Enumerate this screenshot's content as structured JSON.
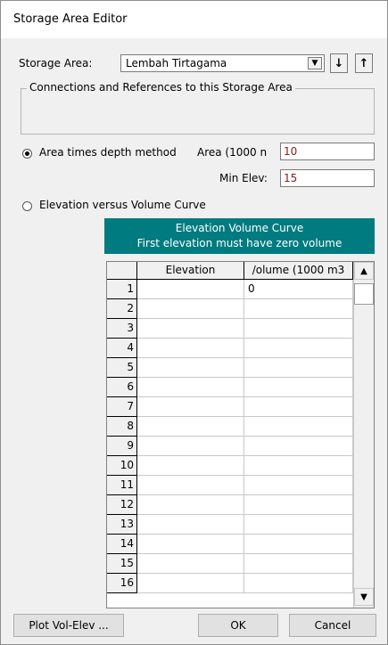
{
  "window": {
    "title": "Storage Area Editor"
  },
  "storage_area": {
    "label": "Storage Area:",
    "selected": "Lembah Tirtagama",
    "dropdown_icon": "dropdown-arrow",
    "down_icon": "arrow-down",
    "up_icon": "arrow-up",
    "down_glyph": "↓",
    "up_glyph": "↑"
  },
  "connections": {
    "legend": "Connections and References to this Storage Area"
  },
  "area_method": {
    "label": "Area times depth method",
    "selected": true,
    "area_label": "Area (1000 n",
    "area_value": "10",
    "min_elev_label": "Min Elev:",
    "min_elev_value": "15"
  },
  "elev_volume": {
    "label": "Elevation versus Volume Curve",
    "selected": false,
    "header_line1": "Elevation Volume Curve",
    "header_line2": "First elevation must have zero volume"
  },
  "table": {
    "columns": [
      "Elevation",
      "/olume (1000 m3"
    ],
    "rows": [
      {
        "n": "1",
        "elev": "",
        "vol": "0"
      },
      {
        "n": "2",
        "elev": "",
        "vol": ""
      },
      {
        "n": "3",
        "elev": "",
        "vol": ""
      },
      {
        "n": "4",
        "elev": "",
        "vol": ""
      },
      {
        "n": "5",
        "elev": "",
        "vol": ""
      },
      {
        "n": "6",
        "elev": "",
        "vol": ""
      },
      {
        "n": "7",
        "elev": "",
        "vol": ""
      },
      {
        "n": "8",
        "elev": "",
        "vol": ""
      },
      {
        "n": "9",
        "elev": "",
        "vol": ""
      },
      {
        "n": "10",
        "elev": "",
        "vol": ""
      },
      {
        "n": "11",
        "elev": "",
        "vol": ""
      },
      {
        "n": "12",
        "elev": "",
        "vol": ""
      },
      {
        "n": "13",
        "elev": "",
        "vol": ""
      },
      {
        "n": "14",
        "elev": "",
        "vol": ""
      },
      {
        "n": "15",
        "elev": "",
        "vol": ""
      },
      {
        "n": "16",
        "elev": "",
        "vol": ""
      }
    ]
  },
  "buttons": {
    "plot": "Plot Vol-Elev ...",
    "ok": "OK",
    "cancel": "Cancel"
  },
  "colors": {
    "header_bg": "#007b7f",
    "value_text": "#8b1a1a"
  }
}
